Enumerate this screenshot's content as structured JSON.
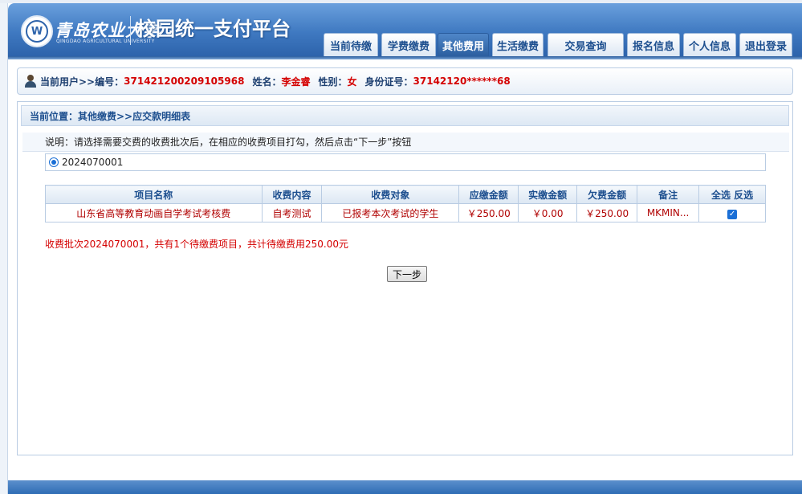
{
  "header": {
    "university_name": "青岛农业大学",
    "university_name_en": "QINGDAO AGRICULTURAL UNIVERSITY",
    "platform_title": "校园统一支付平台",
    "nav": [
      {
        "label": "当前待缴"
      },
      {
        "label": "学费缴费"
      },
      {
        "label": "其他费用",
        "active": true
      },
      {
        "label": "生活缴费"
      },
      {
        "label": "交易查询"
      },
      {
        "label": "报名信息"
      },
      {
        "label": "个人信息"
      },
      {
        "label": "退出登录"
      }
    ]
  },
  "user": {
    "prefix": "当前用户>>",
    "id_label": "编号：",
    "id_value": "371421200209105968",
    "name_label": "姓名：",
    "name_value": "李金睿",
    "gender_label": "性别：",
    "gender_value": "女",
    "idcard_label": "身份证号：",
    "idcard_value": "37142120******68"
  },
  "breadcrumb": "当前位置：其他缴费>>应交款明细表",
  "note": "说明：请选择需要交费的收费批次后，在相应的收费项目打勾，然后点击“下一步”按钮",
  "batch": {
    "value": "2024070001",
    "selected": true
  },
  "table": {
    "headers": [
      "项目名称",
      "收费内容",
      "收费对象",
      "应缴金额",
      "实缴金额",
      "欠费金额",
      "备注",
      "全选 反选"
    ],
    "rows": [
      {
        "name": "山东省高等教育动画自学考试考核费",
        "content": "自考测试",
        "target": "已报考本次考试的学生",
        "due": "￥250.00",
        "paid": "￥0.00",
        "owed": "￥250.00",
        "remark": "MKMIN...",
        "checked": true
      }
    ]
  },
  "summary": "收费批次2024070001，共有1个待缴费项目，共计待缴费用250.00元",
  "next_button": "下一步",
  "colors": {
    "accent": "#2d63ab",
    "alert": "#d40000"
  }
}
